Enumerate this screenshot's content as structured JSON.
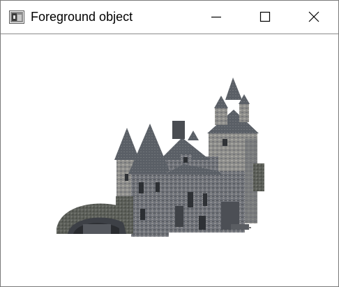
{
  "window": {
    "title": "Foreground object",
    "controls": {
      "minimize_icon": "minimize-icon",
      "maximize_icon": "maximize-icon",
      "close_icon": "close-icon"
    }
  },
  "canvas": {
    "background": "#ffffff",
    "subject": "castle"
  },
  "colors": {
    "stone_dark": "#4e5258",
    "stone_mid": "#6f7279",
    "stone_light": "#9a9a98",
    "roof": "#5a5f66",
    "titlebar_border": "#8a8a8a"
  }
}
